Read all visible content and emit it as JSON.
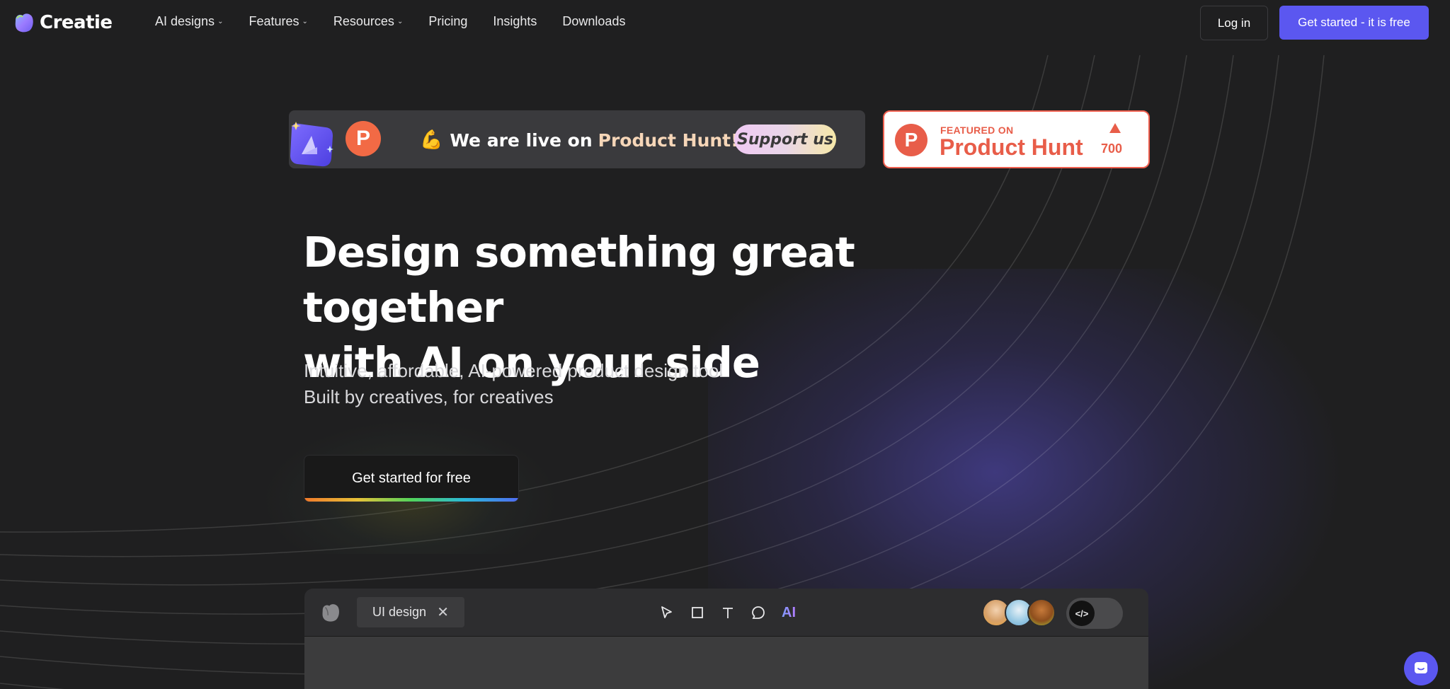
{
  "brand": {
    "name": "Creatie"
  },
  "nav": {
    "items": [
      {
        "label": "AI designs",
        "dropdown": true
      },
      {
        "label": "Features",
        "dropdown": true
      },
      {
        "label": "Resources",
        "dropdown": true
      },
      {
        "label": "Pricing",
        "dropdown": false
      },
      {
        "label": "Insights",
        "dropdown": false
      },
      {
        "label": "Downloads",
        "dropdown": false
      }
    ],
    "login_label": "Log in",
    "cta_label": "Get started - it is free",
    "chevron": "⌄"
  },
  "product_hunt": {
    "badge_letter": "P",
    "emoji": "💪",
    "live_prefix": "We are live on",
    "live_name": "Product Hunt!",
    "support_label": "Support us",
    "featured_small": "FEATURED ON",
    "featured_big": "Product Hunt",
    "votes": "700"
  },
  "hero": {
    "title_line1": "Design something great together",
    "title_line2": "with AI on your side",
    "sub_line1": "Intuitive, affordable, AI-powered product design tool",
    "sub_line2": "Built by creatives, for creatives",
    "button_label": "Get started for free"
  },
  "editor": {
    "tab_label": "UI design",
    "close_glyph": "✕",
    "tools": [
      "pointer-icon",
      "rectangle-icon",
      "text-icon",
      "comment-icon",
      "ai-icon"
    ],
    "ai_label": "AI",
    "code_glyph": "</>"
  },
  "colors": {
    "accent": "#5b57f0",
    "product_hunt": "#e85d49",
    "background": "#1f1f20"
  }
}
